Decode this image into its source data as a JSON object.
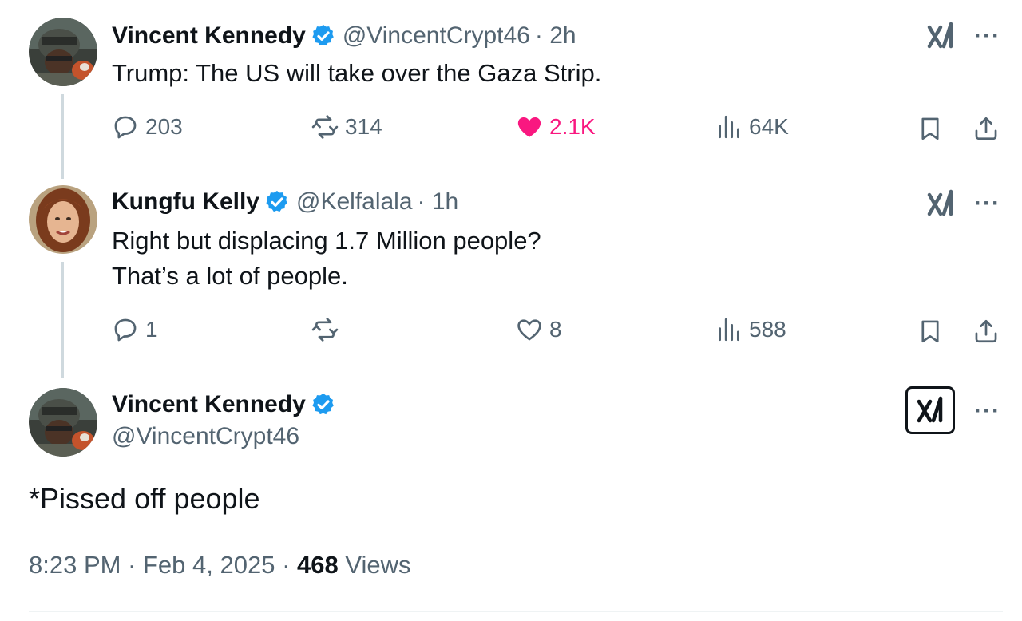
{
  "tweets": [
    {
      "author": "Vincent Kennedy",
      "handle": "@VincentCrypt46",
      "meta": "· 2h",
      "text": "Trump: The US will take over the Gaza Strip.",
      "replies": "203",
      "retweets": "314",
      "likes": "2.1K",
      "views": "64K",
      "liked": true
    },
    {
      "author": "Kungfu Kelly",
      "handle": "@Kelfalala",
      "meta": "· 1h",
      "text_lines": [
        "Right but displacing 1.7 Million people?",
        "That’s a lot of people."
      ],
      "replies": "1",
      "retweets": "",
      "likes": "8",
      "views": "588",
      "liked": false
    }
  ],
  "main_tweet": {
    "author": "Vincent Kennedy",
    "handle": "@VincentCrypt46",
    "text": "*Pissed off people",
    "time": "8:23 PM · Feb 4, 2025 · ",
    "views_count": "468",
    "views_label": " Views"
  },
  "more_label": "···",
  "colors": {
    "like": "#f91880",
    "verified": "#1d9bf0",
    "muted": "#536471",
    "thread_line": "#cfd9de"
  },
  "icons": [
    "verified-badge-icon",
    "xai-grok-icon",
    "reply-icon",
    "retweet-icon",
    "heart-icon",
    "analytics-icon",
    "bookmark-icon",
    "share-icon",
    "more-icon"
  ]
}
